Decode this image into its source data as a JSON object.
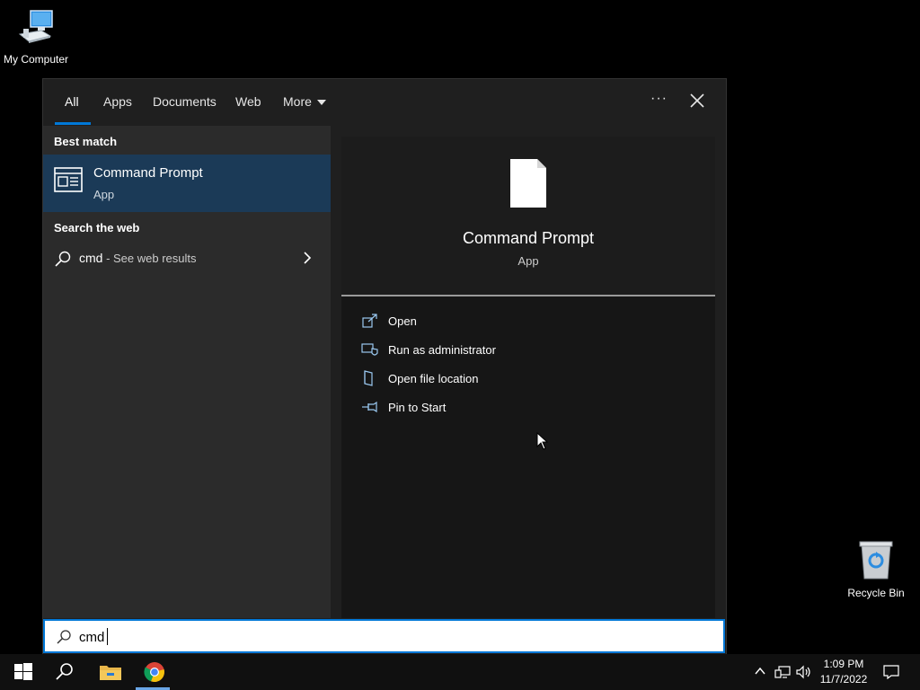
{
  "desktop": {
    "my_computer_label": "My Computer",
    "recycle_bin_label": "Recycle Bin"
  },
  "search_panel": {
    "tabs": [
      {
        "label": "All",
        "active": true
      },
      {
        "label": "Apps"
      },
      {
        "label": "Documents"
      },
      {
        "label": "Web"
      },
      {
        "label": "More"
      }
    ],
    "ellipsis": "···",
    "best_match_heading": "Best match",
    "best_match": {
      "title": "Command Prompt",
      "subtitle": "App"
    },
    "web_heading": "Search the web",
    "web_result": {
      "query": "cmd",
      "suffix": " - See web results"
    },
    "preview": {
      "title": "Command Prompt",
      "subtitle": "App",
      "actions": [
        {
          "label": "Open",
          "icon": "open-icon"
        },
        {
          "label": "Run as administrator",
          "icon": "shield-icon"
        },
        {
          "label": "Open file location",
          "icon": "folder-location-icon"
        },
        {
          "label": "Pin to Start",
          "icon": "pin-icon"
        }
      ]
    },
    "search_box": {
      "value": "cmd"
    }
  },
  "taskbar": {
    "clock_time": "1:09 PM",
    "clock_date": "11/7/2022"
  },
  "colors": {
    "accent": "#0078d7",
    "selected_item_bg": "#1b3a57"
  }
}
